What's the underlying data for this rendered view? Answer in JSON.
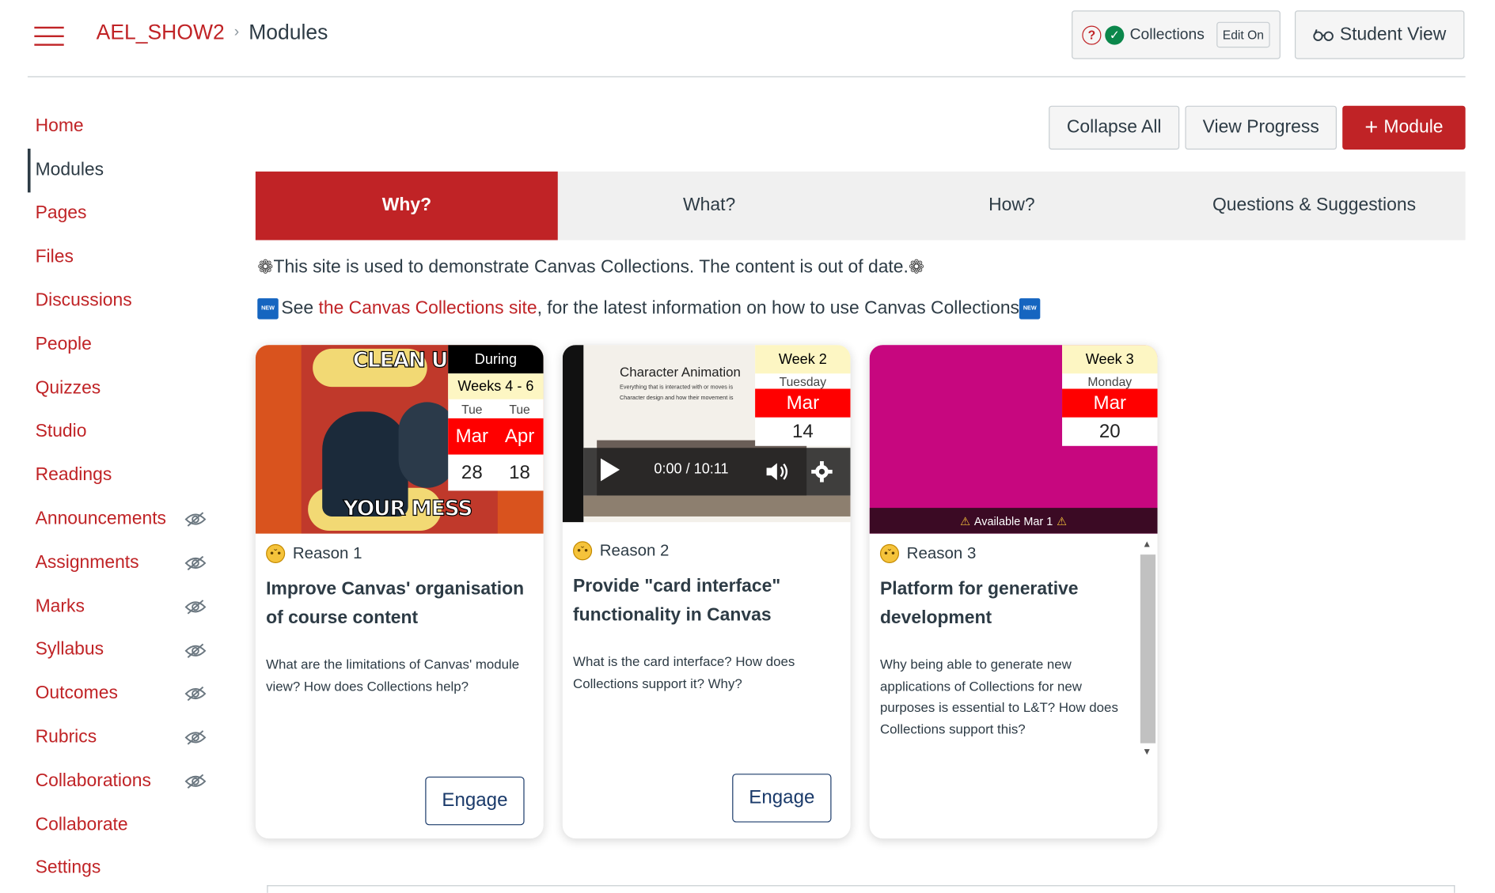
{
  "header": {
    "breadcrumb_course": "AEL_SHOW2",
    "breadcrumb_page": "Modules",
    "collections_label": "Collections",
    "edit_label": "Edit On",
    "student_view_label": "Student View"
  },
  "sidebar": {
    "items": [
      {
        "label": "Home",
        "hidden": false,
        "active": false
      },
      {
        "label": "Modules",
        "hidden": false,
        "active": true
      },
      {
        "label": "Pages",
        "hidden": false,
        "active": false
      },
      {
        "label": "Files",
        "hidden": false,
        "active": false
      },
      {
        "label": "Discussions",
        "hidden": false,
        "active": false
      },
      {
        "label": "People",
        "hidden": false,
        "active": false
      },
      {
        "label": "Quizzes",
        "hidden": false,
        "active": false
      },
      {
        "label": "Studio",
        "hidden": false,
        "active": false
      },
      {
        "label": "Readings",
        "hidden": false,
        "active": false
      },
      {
        "label": "Announcements",
        "hidden": true,
        "active": false
      },
      {
        "label": "Assignments",
        "hidden": true,
        "active": false
      },
      {
        "label": "Marks",
        "hidden": true,
        "active": false
      },
      {
        "label": "Syllabus",
        "hidden": true,
        "active": false
      },
      {
        "label": "Outcomes",
        "hidden": true,
        "active": false
      },
      {
        "label": "Rubrics",
        "hidden": true,
        "active": false
      },
      {
        "label": "Collaborations",
        "hidden": true,
        "active": false
      },
      {
        "label": "Collaborate",
        "hidden": false,
        "active": false
      },
      {
        "label": "Settings",
        "hidden": false,
        "active": false
      }
    ]
  },
  "toolbar": {
    "collapse_all": "Collapse All",
    "view_progress": "View Progress",
    "add_module": "Module"
  },
  "tabs": [
    {
      "label": "Why?",
      "active": true
    },
    {
      "label": "What?",
      "active": false
    },
    {
      "label": "How?",
      "active": false
    },
    {
      "label": "Questions & Suggestions",
      "active": false
    }
  ],
  "notice": {
    "line1": "This site is used to demonstrate Canvas Collections. The content is out of date.",
    "line2_prefix": "See ",
    "line2_link": "the Canvas Collections site",
    "line2_suffix": ", for the latest information on how to use Canvas Collections",
    "new_badge": "NEW"
  },
  "cards": [
    {
      "image_text_top": "CLEAN UP",
      "image_text_bottom": "YOUR MESS",
      "date_label": "During",
      "date_weeks": "Weeks 4 - 6",
      "date_day1": "Tue",
      "date_day2": "Tue",
      "date_month1": "Mar",
      "date_month2": "Apr",
      "date_num1": "28",
      "date_num2": "18",
      "reason": "Reason 1",
      "title": "Improve Canvas' organisation of course content",
      "description": "What are the  limitations of Canvas' module view? How does Collections help?",
      "button": "Engage"
    },
    {
      "video_title": "Character Animation",
      "video_bullet1": "Everything that is interacted with or moves is",
      "video_bullet2": "Character design and how their movement is",
      "video_time": "0:00 / 10:11",
      "date_label": "Week 2",
      "date_day": "Tuesday",
      "date_month": "Mar",
      "date_num": "14",
      "reason": "Reason 2",
      "title": "Provide \"card interface\" functionality in Canvas",
      "description": "What is the card interface? How does Collections support it? Why?",
      "button": "Engage"
    },
    {
      "availability": "Available Mar 1",
      "date_label": "Week 3",
      "date_day": "Monday",
      "date_month": "Mar",
      "date_num": "20",
      "reason": "Reason 3",
      "title": "Platform for generative development",
      "description": "Why being able to generate new applications of Collections for new purposes is essential to L&T? How does Collections support this?"
    }
  ],
  "colors": {
    "brand_red": "#c02326",
    "date_red": "#ff0000",
    "text": "#2d3b45",
    "magenta": "#c7077f"
  }
}
